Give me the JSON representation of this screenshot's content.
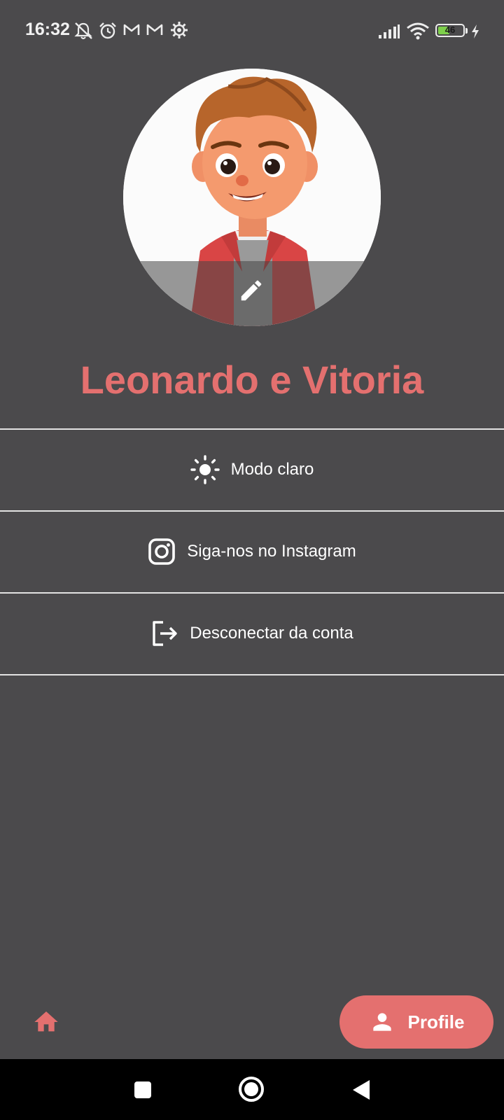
{
  "status_bar": {
    "time": "16:32",
    "left_icons": [
      "bell-muted-icon",
      "alarm-icon",
      "gmail-icon",
      "gmail-icon",
      "settings-gear-icon"
    ],
    "right_icons": [
      "signal-icon",
      "wifi-icon",
      "battery-icon",
      "charging-icon"
    ],
    "battery_level": "46"
  },
  "profile": {
    "avatar_icon": "avatar-cartoon-boy",
    "edit_icon": "pencil-icon",
    "name": "Leonardo e Vitoria"
  },
  "menu": {
    "items": [
      {
        "icon": "sun-icon",
        "label": "Modo claro"
      },
      {
        "icon": "instagram-icon",
        "label": "Siga-nos no Instagram"
      },
      {
        "icon": "logout-icon",
        "label": "Desconectar da conta"
      }
    ]
  },
  "bottom_nav": {
    "home_icon": "home-icon",
    "profile_icon": "person-icon",
    "profile_label": "Profile"
  },
  "system_nav": {
    "buttons": [
      "recents-square-icon",
      "home-circle-icon",
      "back-triangle-icon"
    ]
  },
  "colors": {
    "background": "#4b4a4c",
    "accent": "#e4706f",
    "divider": "#e3e3e3",
    "battery_fill": "#7ed04b",
    "system_nav": "#000000"
  }
}
